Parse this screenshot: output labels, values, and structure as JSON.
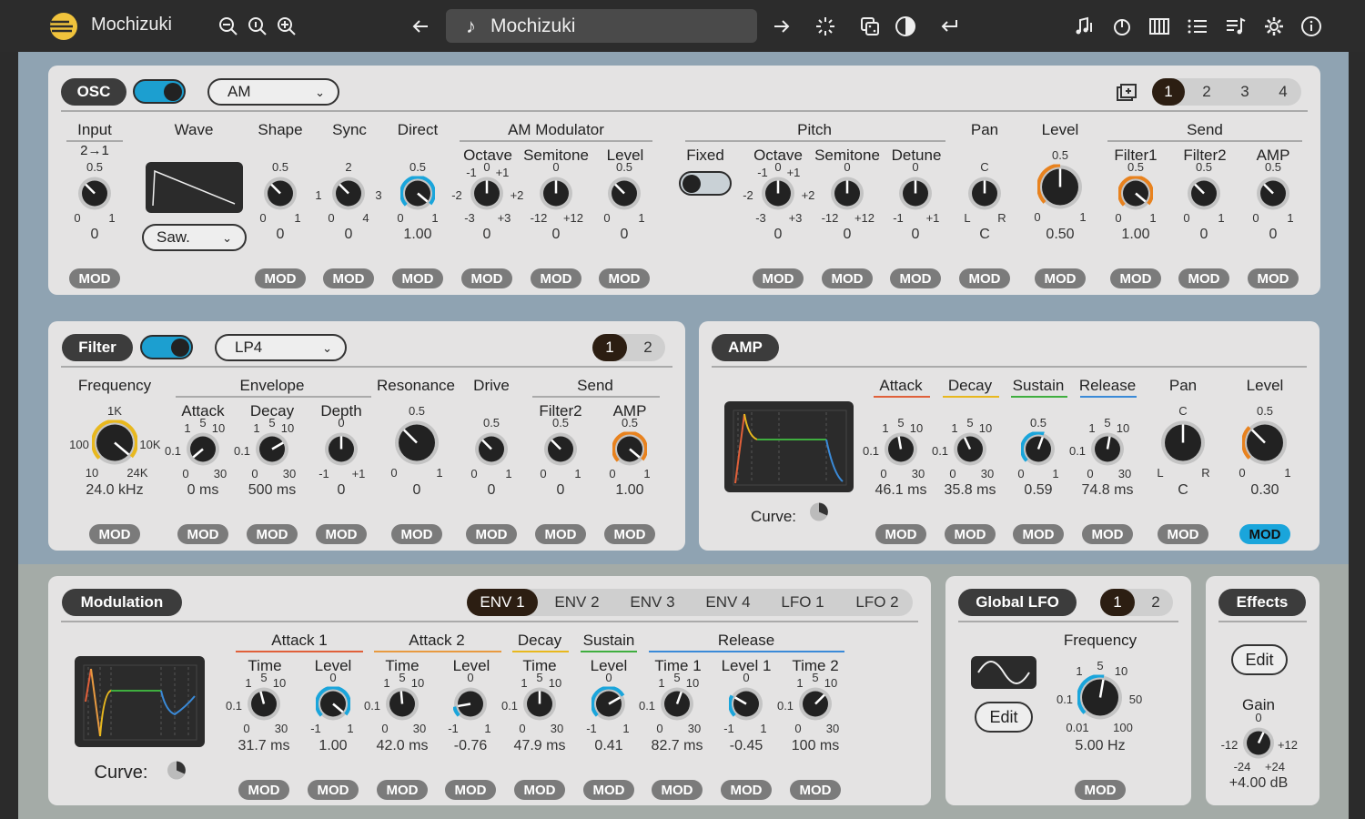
{
  "topbar": {
    "app_name": "Mochizuki",
    "preset_name": "Mochizuki"
  },
  "osc": {
    "tag": "OSC",
    "type": "AM",
    "tabs": [
      "1",
      "2",
      "3",
      "4"
    ],
    "sections": {
      "am": "AM Modulator",
      "pitch": "Pitch",
      "send": "Send"
    },
    "input": {
      "label": "Input",
      "sub": "2→1",
      "top": "0.5",
      "min": "0",
      "max": "1",
      "value": "0"
    },
    "wave": {
      "label": "Wave",
      "select": "Saw."
    },
    "shape": {
      "label": "Shape",
      "top": "0.5",
      "min": "0",
      "max": "1",
      "value": "0"
    },
    "sync": {
      "label": "Sync",
      "top": "2",
      "l": "1",
      "r": "3",
      "min": "0",
      "max": "4",
      "value": "0"
    },
    "direct": {
      "label": "Direct",
      "top": "0.5",
      "min": "0",
      "max": "1",
      "value": "1.00"
    },
    "am_oct": {
      "label": "Octave",
      "top": "0",
      "tl": "-1",
      "tr": "+1",
      "l": "-2",
      "r": "+2",
      "min": "-3",
      "max": "+3",
      "value": "0"
    },
    "am_semi": {
      "label": "Semitone",
      "top": "0",
      "min": "-12",
      "max": "+12",
      "value": "0"
    },
    "am_level": {
      "label": "Level",
      "top": "0.5",
      "min": "0",
      "max": "1",
      "value": "0"
    },
    "fixed": {
      "label": "Fixed"
    },
    "p_oct": {
      "label": "Octave",
      "top": "0",
      "tl": "-1",
      "tr": "+1",
      "l": "-2",
      "r": "+2",
      "min": "-3",
      "max": "+3",
      "value": "0"
    },
    "p_semi": {
      "label": "Semitone",
      "top": "0",
      "min": "-12",
      "max": "+12",
      "value": "0"
    },
    "detune": {
      "label": "Detune",
      "top": "0",
      "min": "-1",
      "max": "+1",
      "value": "0"
    },
    "pan": {
      "label": "Pan",
      "top": "C",
      "min": "L",
      "max": "R",
      "value": "C"
    },
    "level": {
      "label": "Level",
      "top": "0.5",
      "min": "0",
      "max": "1",
      "value": "0.50"
    },
    "f1": {
      "label": "Filter1",
      "top": "0.5",
      "min": "0",
      "max": "1",
      "value": "1.00"
    },
    "f2": {
      "label": "Filter2",
      "top": "0.5",
      "min": "0",
      "max": "1",
      "value": "0"
    },
    "amp": {
      "label": "AMP",
      "top": "0.5",
      "min": "0",
      "max": "1",
      "value": "0"
    }
  },
  "filter": {
    "tag": "Filter",
    "type": "LP4",
    "tabs": [
      "1",
      "2"
    ],
    "sections": {
      "env": "Envelope",
      "send": "Send"
    },
    "freq": {
      "label": "Frequency",
      "top": "1K",
      "l": "100",
      "r": "10K",
      "min": "10",
      "max": "24K",
      "value": "24.0 kHz"
    },
    "attack": {
      "label": "Attack",
      "top": "5",
      "tl": "1",
      "tr": "10",
      "l": "0.1",
      "min": "0",
      "max": "30",
      "value": "0 ms"
    },
    "decay": {
      "label": "Decay",
      "top": "5",
      "tl": "1",
      "tr": "10",
      "l": "0.1",
      "min": "0",
      "max": "30",
      "value": "500 ms"
    },
    "depth": {
      "label": "Depth",
      "top": "0",
      "min": "-1",
      "max": "+1",
      "value": "0"
    },
    "reso": {
      "label": "Resonance",
      "top": "0.5",
      "min": "0",
      "max": "1",
      "value": "0"
    },
    "drive": {
      "label": "Drive",
      "top": "0.5",
      "min": "0",
      "max": "1",
      "value": "0"
    },
    "f2": {
      "label": "Filter2",
      "top": "0.5",
      "min": "0",
      "max": "1",
      "value": "0"
    },
    "amp": {
      "label": "AMP",
      "top": "0.5",
      "min": "0",
      "max": "1",
      "value": "1.00"
    }
  },
  "amp": {
    "tag": "AMP",
    "curve": "Curve:",
    "attack": {
      "label": "Attack",
      "top": "5",
      "tl": "1",
      "tr": "10",
      "l": "0.1",
      "min": "0",
      "max": "30",
      "value": "46.1 ms"
    },
    "decay": {
      "label": "Decay",
      "top": "5",
      "tl": "1",
      "tr": "10",
      "l": "0.1",
      "min": "0",
      "max": "30",
      "value": "35.8 ms"
    },
    "sustain": {
      "label": "Sustain",
      "top": "0.5",
      "min": "0",
      "max": "1",
      "value": "0.59"
    },
    "release": {
      "label": "Release",
      "top": "5",
      "tl": "1",
      "tr": "10",
      "l": "0.1",
      "min": "0",
      "max": "30",
      "value": "74.8 ms"
    },
    "pan": {
      "label": "Pan",
      "top": "C",
      "min": "L",
      "max": "R",
      "value": "C"
    },
    "level": {
      "label": "Level",
      "top": "0.5",
      "min": "0",
      "max": "1",
      "value": "0.30"
    }
  },
  "mod": {
    "tag": "Modulation",
    "tabs": [
      "ENV 1",
      "ENV 2",
      "ENV 3",
      "ENV 4",
      "LFO 1",
      "LFO 2"
    ],
    "curve": "Curve:",
    "sections": {
      "a1": "Attack 1",
      "a2": "Attack 2",
      "d": "Decay",
      "s": "Sustain",
      "r": "Release"
    },
    "a1t": {
      "label": "Time",
      "top": "5",
      "tl": "1",
      "tr": "10",
      "l": "0.1",
      "min": "0",
      "max": "30",
      "value": "31.7 ms"
    },
    "a1l": {
      "label": "Level",
      "top": "0",
      "min": "-1",
      "max": "1",
      "value": "1.00"
    },
    "a2t": {
      "label": "Time",
      "top": "5",
      "tl": "1",
      "tr": "10",
      "l": "0.1",
      "min": "0",
      "max": "30",
      "value": "42.0 ms"
    },
    "a2l": {
      "label": "Level",
      "top": "0",
      "min": "-1",
      "max": "1",
      "value": "-0.76"
    },
    "dt": {
      "label": "Time",
      "top": "5",
      "tl": "1",
      "tr": "10",
      "l": "0.1",
      "min": "0",
      "max": "30",
      "value": "47.9 ms"
    },
    "sl": {
      "label": "Level",
      "top": "0",
      "min": "-1",
      "max": "1",
      "value": "0.41"
    },
    "r1t": {
      "label": "Time 1",
      "top": "5",
      "tl": "1",
      "tr": "10",
      "l": "0.1",
      "min": "0",
      "max": "30",
      "value": "82.7 ms"
    },
    "r1l": {
      "label": "Level 1",
      "top": "0",
      "min": "-1",
      "max": "1",
      "value": "-0.45"
    },
    "r2t": {
      "label": "Time 2",
      "top": "5",
      "tl": "1",
      "tr": "10",
      "l": "0.1",
      "min": "0",
      "max": "30",
      "value": "100 ms"
    }
  },
  "glfo": {
    "tag": "Global LFO",
    "tabs": [
      "1",
      "2"
    ],
    "edit": "Edit",
    "freq": {
      "label": "Frequency",
      "top": "5",
      "tr": "10",
      "tl": "1",
      "l": "0.1",
      "r": "50",
      "min": "0.01",
      "max": "100",
      "value": "5.00 Hz"
    }
  },
  "effects": {
    "tag": "Effects",
    "edit": "Edit",
    "gain": {
      "label": "Gain",
      "top": "0",
      "l": "-12",
      "r": "+12",
      "min": "-24",
      "max": "+24",
      "value": "+4.00 dB"
    }
  },
  "mod_label": "MOD",
  "colors": {
    "accent": "#1aa5db",
    "orange": "#e8821e",
    "yellow": "#e8b81e",
    "panel": "#e4e3e3"
  }
}
